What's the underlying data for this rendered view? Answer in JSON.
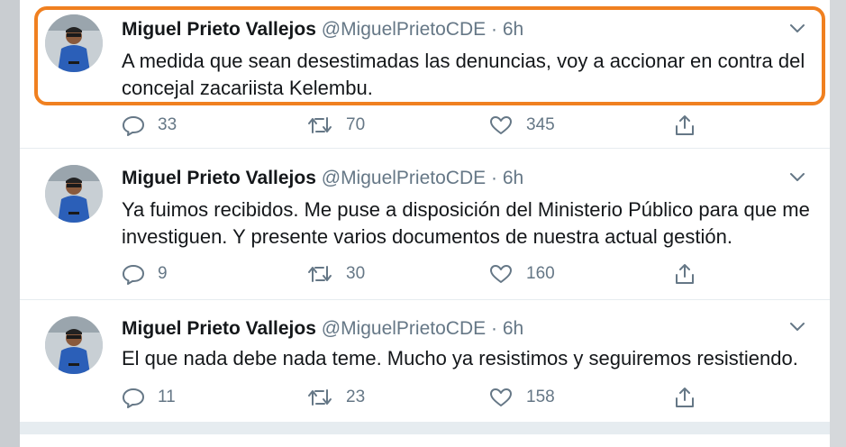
{
  "tweets": [
    {
      "author_name": "Miguel Prieto Vallejos",
      "handle": "@MiguelPrietoCDE",
      "separator": "·",
      "time": "6h",
      "text": "A medida que sean desestimadas las denuncias, voy a accionar en contra del concejal zacariista Kelembu.",
      "replies": "33",
      "retweets": "70",
      "likes": "345"
    },
    {
      "author_name": "Miguel Prieto Vallejos",
      "handle": "@MiguelPrietoCDE",
      "separator": "·",
      "time": "6h",
      "text": "Ya fuimos recibidos. Me puse a disposición del Ministerio Público para que me investiguen. Y presente varios documentos de nuestra actual gestión.",
      "replies": "9",
      "retweets": "30",
      "likes": "160"
    },
    {
      "author_name": "Miguel Prieto Vallejos",
      "handle": "@MiguelPrietoCDE",
      "separator": "·",
      "time": "6h",
      "text": "El que nada debe nada teme. Mucho ya resistimos y seguiremos resistiendo.",
      "replies": "11",
      "retweets": "23",
      "likes": "158"
    }
  ],
  "colors": {
    "highlight": "#f08020",
    "muted_text": "#657786",
    "primary_text": "#14171a",
    "divider": "#e6ecf0"
  },
  "icons": [
    "reply-icon",
    "retweet-icon",
    "like-icon",
    "share-icon",
    "chevron-down-icon"
  ]
}
